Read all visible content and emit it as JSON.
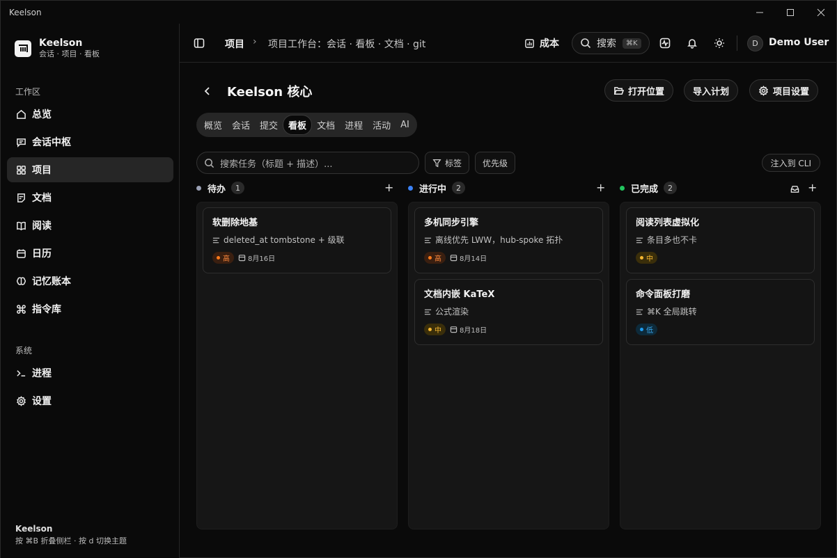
{
  "window": {
    "title": "Keelson"
  },
  "brand": {
    "name": "Keelson",
    "subtitle": "会话 · 项目 · 看板"
  },
  "sidebar": {
    "workspace_label": "工作区",
    "items": [
      {
        "label": "总览",
        "icon": "home-icon"
      },
      {
        "label": "会话中枢",
        "icon": "chat-icon"
      },
      {
        "label": "项目",
        "icon": "grid-icon",
        "active": true
      },
      {
        "label": "文档",
        "icon": "document-icon"
      },
      {
        "label": "阅读",
        "icon": "book-icon"
      },
      {
        "label": "日历",
        "icon": "calendar-icon"
      },
      {
        "label": "记忆账本",
        "icon": "brain-icon"
      },
      {
        "label": "指令库",
        "icon": "command-icon"
      }
    ],
    "system_label": "系统",
    "system_items": [
      {
        "label": "进程",
        "icon": "terminal-icon"
      },
      {
        "label": "设置",
        "icon": "gear-icon"
      }
    ],
    "footer_title": "Keelson",
    "footer_hint": "按 ⌘B 折叠侧栏 · 按 d 切换主题"
  },
  "topbar": {
    "crumb_root": "项目",
    "crumb_current": "项目工作台：会话 · 看板 · 文档 · git",
    "cost_label": "成本",
    "search_label": "搜索",
    "search_shortcut": "⌘K",
    "user_initial": "D",
    "user_name": "Demo User"
  },
  "project": {
    "title": "Keelson 核心",
    "actions": {
      "open_location": "打开位置",
      "import_plan": "导入计划",
      "settings": "项目设置"
    },
    "tabs": [
      "概览",
      "会话",
      "提交",
      "看板",
      "文档",
      "进程",
      "活动",
      "AI"
    ],
    "active_tab": "看板"
  },
  "board": {
    "search_placeholder": "搜索任务（标题 + 描述）...",
    "tag_filter": "标签",
    "priority_filter": "优先级",
    "inject_cli": "注入到 CLI",
    "columns": [
      {
        "title": "待办",
        "count": "1",
        "dot_color": "#9aa0b4",
        "cards": [
          {
            "title": "软删除地基",
            "desc": "deleted_at tombstone + 级联",
            "priority": "高",
            "priority_level": "high",
            "date": "8月16日"
          }
        ]
      },
      {
        "title": "进行中",
        "count": "2",
        "dot_color": "#3b82f6",
        "cards": [
          {
            "title": "多机同步引擎",
            "desc": "离线优先 LWW，hub-spoke 拓扑",
            "priority": "高",
            "priority_level": "high",
            "date": "8月14日"
          },
          {
            "title": "文档内嵌 KaTeX",
            "desc": "公式渲染",
            "priority": "中",
            "priority_level": "mid",
            "date": "8月18日"
          }
        ]
      },
      {
        "title": "已完成",
        "count": "2",
        "dot_color": "#22c55e",
        "cards": [
          {
            "title": "阅读列表虚拟化",
            "desc": "条目多也不卡",
            "priority": "中",
            "priority_level": "mid"
          },
          {
            "title": "命令面板打磨",
            "desc": "⌘K 全局跳转",
            "priority": "低",
            "priority_level": "low"
          }
        ]
      }
    ]
  }
}
